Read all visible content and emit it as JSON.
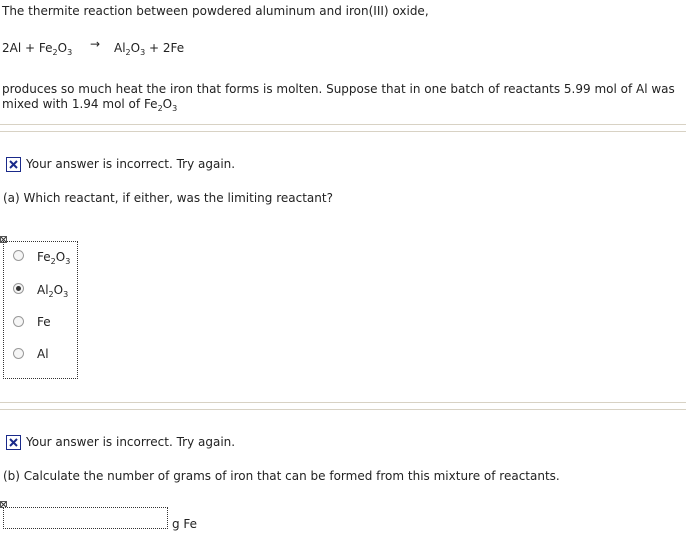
{
  "intro": "The thermite reaction between powdered aluminum and iron(III) oxide,",
  "equation": {
    "reactant_a": "2Al",
    "plus": "+",
    "reactant_b": "Fe2O3",
    "arrow": "→",
    "product_a": "Al2O3",
    "product_b": "+ 2Fe"
  },
  "problem_line1": "produces so much heat the iron that forms is molten. Suppose that in one batch of reactants 5.99 mol of Al was",
  "problem_line2": "mixed with 1.94 mol of Fe2O3",
  "part_a": {
    "feedback": "Your answer is incorrect.  Try again.",
    "question": "(a) Which reactant, if either, was the limiting reactant?",
    "options": [
      {
        "label": "Fe2O3",
        "selected": false
      },
      {
        "label": "Al2O3",
        "selected": true
      },
      {
        "label": "Fe",
        "selected": false
      },
      {
        "label": "Al",
        "selected": false
      }
    ]
  },
  "part_b": {
    "feedback": "Your answer is incorrect.  Try again.",
    "question": "(b) Calculate the number of grams of iron that can be formed from this mixture of reactants.",
    "input_value": "",
    "unit": "g Fe"
  },
  "colors": {
    "incorrect_icon": "#1a2a8a",
    "rule": "#d8d2c4"
  }
}
